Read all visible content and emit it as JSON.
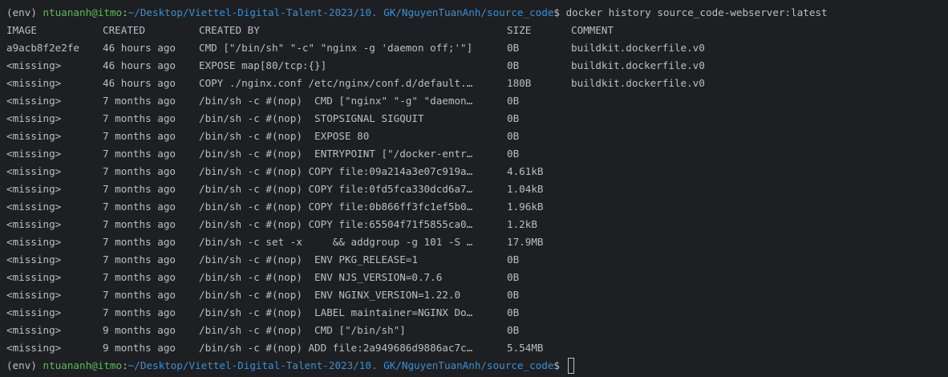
{
  "terminal": {
    "prompt": {
      "env": "(env) ",
      "user_host": "ntuananh@itmo",
      "separator": ":",
      "path": "~/Desktop/Viettel-Digital-Talent-2023/10. GK/NguyenTuanAnh/source_code",
      "symbol": "$ "
    },
    "command": "docker history source_code-webserver:latest",
    "headers": {
      "image": "IMAGE",
      "created": "CREATED",
      "created_by": "CREATED BY",
      "size": "SIZE",
      "comment": "COMMENT"
    },
    "rows": [
      {
        "image": "a9acb8f2e2fe",
        "created": "46 hours ago",
        "created_by": "CMD [\"/bin/sh\" \"-c\" \"nginx -g 'daemon off;'\"]",
        "size": "0B",
        "comment": "buildkit.dockerfile.v0"
      },
      {
        "image": "<missing>",
        "created": "46 hours ago",
        "created_by": "EXPOSE map[80/tcp:{}]",
        "size": "0B",
        "comment": "buildkit.dockerfile.v0"
      },
      {
        "image": "<missing>",
        "created": "46 hours ago",
        "created_by": "COPY ./nginx.conf /etc/nginx/conf.d/default.…",
        "size": "180B",
        "comment": "buildkit.dockerfile.v0"
      },
      {
        "image": "<missing>",
        "created": "7 months ago",
        "created_by": "/bin/sh -c #(nop)  CMD [\"nginx\" \"-g\" \"daemon…",
        "size": "0B",
        "comment": ""
      },
      {
        "image": "<missing>",
        "created": "7 months ago",
        "created_by": "/bin/sh -c #(nop)  STOPSIGNAL SIGQUIT",
        "size": "0B",
        "comment": ""
      },
      {
        "image": "<missing>",
        "created": "7 months ago",
        "created_by": "/bin/sh -c #(nop)  EXPOSE 80",
        "size": "0B",
        "comment": ""
      },
      {
        "image": "<missing>",
        "created": "7 months ago",
        "created_by": "/bin/sh -c #(nop)  ENTRYPOINT [\"/docker-entr…",
        "size": "0B",
        "comment": ""
      },
      {
        "image": "<missing>",
        "created": "7 months ago",
        "created_by": "/bin/sh -c #(nop) COPY file:09a214a3e07c919a…",
        "size": "4.61kB",
        "comment": ""
      },
      {
        "image": "<missing>",
        "created": "7 months ago",
        "created_by": "/bin/sh -c #(nop) COPY file:0fd5fca330dcd6a7…",
        "size": "1.04kB",
        "comment": ""
      },
      {
        "image": "<missing>",
        "created": "7 months ago",
        "created_by": "/bin/sh -c #(nop) COPY file:0b866ff3fc1ef5b0…",
        "size": "1.96kB",
        "comment": ""
      },
      {
        "image": "<missing>",
        "created": "7 months ago",
        "created_by": "/bin/sh -c #(nop) COPY file:65504f71f5855ca0…",
        "size": "1.2kB",
        "comment": ""
      },
      {
        "image": "<missing>",
        "created": "7 months ago",
        "created_by": "/bin/sh -c set -x     && addgroup -g 101 -S …",
        "size": "17.9MB",
        "comment": ""
      },
      {
        "image": "<missing>",
        "created": "7 months ago",
        "created_by": "/bin/sh -c #(nop)  ENV PKG_RELEASE=1",
        "size": "0B",
        "comment": ""
      },
      {
        "image": "<missing>",
        "created": "7 months ago",
        "created_by": "/bin/sh -c #(nop)  ENV NJS_VERSION=0.7.6",
        "size": "0B",
        "comment": ""
      },
      {
        "image": "<missing>",
        "created": "7 months ago",
        "created_by": "/bin/sh -c #(nop)  ENV NGINX_VERSION=1.22.0",
        "size": "0B",
        "comment": ""
      },
      {
        "image": "<missing>",
        "created": "7 months ago",
        "created_by": "/bin/sh -c #(nop)  LABEL maintainer=NGINX Do…",
        "size": "0B",
        "comment": ""
      },
      {
        "image": "<missing>",
        "created": "9 months ago",
        "created_by": "/bin/sh -c #(nop)  CMD [\"/bin/sh\"]",
        "size": "0B",
        "comment": ""
      },
      {
        "image": "<missing>",
        "created": "9 months ago",
        "created_by": "/bin/sh -c #(nop) ADD file:2a949686d9886ac7c…",
        "size": "5.54MB",
        "comment": ""
      }
    ],
    "colors": {
      "background": "#1e1f22",
      "text": "#bcbec4",
      "user_host": "#5fb85f",
      "path": "#3d8fd1"
    }
  }
}
